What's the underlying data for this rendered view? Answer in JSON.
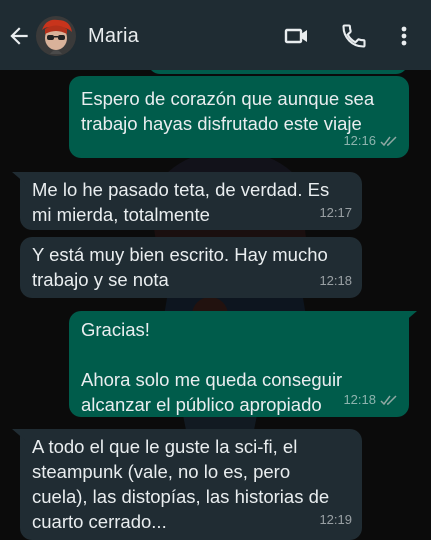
{
  "header": {
    "contact_name": "Maria",
    "icons": [
      "back-arrow-icon",
      "avatar",
      "video-call-icon",
      "phone-icon",
      "more-vert-icon"
    ]
  },
  "colors": {
    "header_bg": "#1f2c33",
    "outgoing_bubble": "#005c4b",
    "incoming_bubble": "#202c33",
    "chat_bg": "#0b0b0b",
    "read_ticks": "#8fa8a3"
  },
  "messages": [
    {
      "direction": "outgoing",
      "text": "Espero de corazón que aunque sea trabajo hayas disfrutado este viaje",
      "time": "12:16",
      "status": "read"
    },
    {
      "direction": "incoming",
      "text": "Me lo he pasado teta, de verdad. Es mi mierda, totalmente",
      "time": "12:17"
    },
    {
      "direction": "incoming",
      "text": "Y está muy bien escrito. Hay mucho trabajo y se nota",
      "time": "12:18"
    },
    {
      "direction": "outgoing",
      "text": "Gracias!\n\nAhora solo me queda conseguir alcanzar el público apropiado",
      "time": "12:18",
      "status": "read"
    },
    {
      "direction": "incoming",
      "text": "A todo el que le guste la sci-fi, el steampunk (vale, no lo es, pero cuela), las distopías, las historias de cuarto cerrado...",
      "time": "12:19"
    }
  ]
}
